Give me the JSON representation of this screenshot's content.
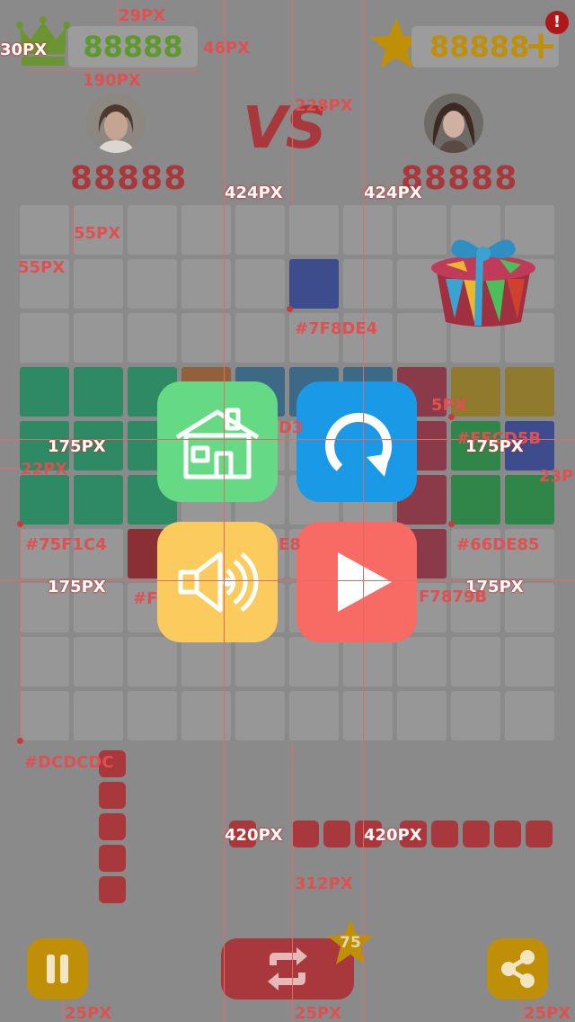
{
  "header": {
    "left_score": "88888",
    "right_score": "88888",
    "plus_label": "+",
    "alert_label": "!",
    "vs_label": "VS"
  },
  "players": {
    "left_score": "88888",
    "right_score": "88888"
  },
  "menu": {
    "home_icon": "home-icon",
    "restart_icon": "restart-icon",
    "sound_icon": "sound-icon",
    "play_icon": "play-icon"
  },
  "bottom": {
    "badge_count": "75"
  },
  "annotations": {
    "a29": "29PX",
    "a30": "30PX",
    "a46": "46PX",
    "a190": "190PX",
    "a228": "228PX",
    "a424l": "424PX",
    "a424r": "424PX",
    "a55a": "55PX",
    "a55b": "55PX",
    "c7f8de4": "#7F8DE4",
    "a5": "5PX",
    "a175a": "175PX",
    "a175b": "175PX",
    "a175c": "175PX",
    "a175d": "175PX",
    "a22": "22PX",
    "a23": "23P",
    "cffcd5b": "#FFCD5B",
    "c75f1c4": "#75F1C4",
    "c66de85": "#66DE85",
    "cf7879b": "F7879B",
    "cfpart": "#F",
    "cmid1": "D3",
    "cmid2": "E8",
    "cdcdcdc": "#DCDCDC",
    "a420l": "420PX",
    "a420r": "420PX",
    "a312": "312PX",
    "a25a": "25PX",
    "a25b": "25PX",
    "a25c": "25PX"
  },
  "colors": {
    "overlay_bg": "#8a8a8a",
    "empty_cell": "#979797",
    "home_btn": "#66d985",
    "restart_btn": "#1a99e6",
    "sound_btn": "#fccb5e",
    "play_btn": "#f76b64",
    "score_red": "#a8383b",
    "gold": "#bf8f08",
    "green_score": "#5d9a2a"
  }
}
